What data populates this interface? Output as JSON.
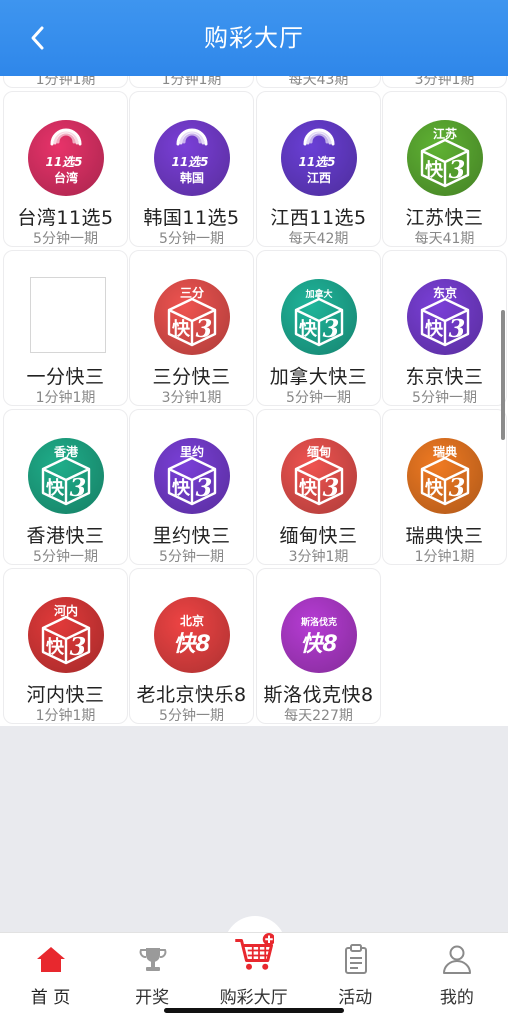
{
  "header": {
    "title": "购彩大厅",
    "back_icon": "chevron-left-icon"
  },
  "partial_row": [
    "1分钟1期",
    "1分钟1期",
    "每天43期",
    "3分钟1期"
  ],
  "games": [
    {
      "name": "台湾11选5",
      "period": "5分钟一期",
      "badge": "台湾",
      "logo_kind": "11x5",
      "color": "#e8336a"
    },
    {
      "name": "韩国11选5",
      "period": "5分钟一期",
      "badge": "韩国",
      "logo_kind": "11x5",
      "color": "#7a3fd8"
    },
    {
      "name": "江西11选5",
      "period": "每天42期",
      "badge": "江西",
      "logo_kind": "11x5",
      "color": "#6a3fd6"
    },
    {
      "name": "江苏快三",
      "period": "每天41期",
      "badge": "江苏",
      "logo_kind": "k3",
      "color": "#5fb233"
    },
    {
      "name": "一分快三",
      "period": "1分钟1期",
      "badge": "",
      "logo_kind": "blank",
      "color": "#ffffff"
    },
    {
      "name": "三分快三",
      "period": "3分钟1期",
      "badge": "三分",
      "logo_kind": "k3",
      "color": "#ef5350"
    },
    {
      "name": "加拿大快三",
      "period": "5分钟一期",
      "badge": "加拿大",
      "logo_kind": "k3",
      "color": "#1fb59a"
    },
    {
      "name": "东京快三",
      "period": "5分钟一期",
      "badge": "东京",
      "logo_kind": "k3",
      "color": "#7a3fd8"
    },
    {
      "name": "香港快三",
      "period": "5分钟一期",
      "badge": "香港",
      "logo_kind": "k3",
      "color": "#1fae8a"
    },
    {
      "name": "里约快三",
      "period": "5分钟一期",
      "badge": "里约",
      "logo_kind": "k3",
      "color": "#7a3fd8"
    },
    {
      "name": "缅甸快三",
      "period": "3分钟1期",
      "badge": "缅甸",
      "logo_kind": "k3",
      "color": "#ef5350"
    },
    {
      "name": "瑞典快三",
      "period": "1分钟1期",
      "badge": "瑞典",
      "logo_kind": "k3",
      "color": "#f07a22"
    },
    {
      "name": "河内快三",
      "period": "1分钟1期",
      "badge": "河内",
      "logo_kind": "k3",
      "color": "#e23a3a"
    },
    {
      "name": "老北京快乐8",
      "period": "5分钟一期",
      "badge": "北京",
      "logo_kind": "k8",
      "color": "#ef4444"
    },
    {
      "name": "斯洛伐克快8",
      "period": "每天227期",
      "badge": "斯洛伐克",
      "logo_kind": "k8",
      "color": "#b63cd4"
    }
  ],
  "tabbar": [
    {
      "label": "首 页",
      "icon": "home-icon",
      "active": true
    },
    {
      "label": "开奖",
      "icon": "trophy-icon",
      "active": false
    },
    {
      "label": "购彩大厅",
      "icon": "cart-icon",
      "active": false
    },
    {
      "label": "活动",
      "icon": "clipboard-icon",
      "active": false
    },
    {
      "label": "我的",
      "icon": "user-icon",
      "active": false
    }
  ],
  "colors": {
    "header": "#3b93ef",
    "accent_red": "#e8282e"
  }
}
